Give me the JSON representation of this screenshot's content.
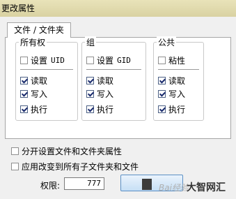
{
  "window": {
    "title": "更改属性"
  },
  "tab": {
    "label": "文件 / 文件夹"
  },
  "groups": [
    {
      "title": "所有权",
      "special_label": "设置",
      "special_suffix": "UID",
      "special_checked": false,
      "read_label": "读取",
      "read_checked": true,
      "write_label": "写入",
      "write_checked": true,
      "exec_label": "执行",
      "exec_checked": true
    },
    {
      "title": "组",
      "special_label": "设置",
      "special_suffix": "GID",
      "special_checked": false,
      "read_label": "读取",
      "read_checked": true,
      "write_label": "写入",
      "write_checked": true,
      "exec_label": "执行",
      "exec_checked": true
    },
    {
      "title": "公共",
      "special_label": "粘性",
      "special_suffix": "",
      "special_checked": false,
      "read_label": "读取",
      "read_checked": true,
      "write_label": "写入",
      "write_checked": true,
      "exec_label": "执行",
      "exec_checked": true
    }
  ],
  "options": {
    "separate_label": "分开设置文件和文件夹属性",
    "separate_checked": false,
    "recursive_label": "应用改变到所有子文件夹和文件",
    "recursive_checked": false
  },
  "permissions": {
    "label": "权限:",
    "value": "777"
  },
  "watermark": {
    "text": "大智网汇",
    "baidu": "Bai经验"
  }
}
